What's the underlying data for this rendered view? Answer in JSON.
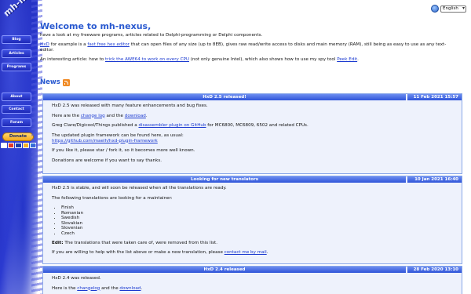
{
  "site": {
    "logo_text": "mh-nexus"
  },
  "nav": {
    "items": [
      "Blog",
      "Articles",
      "Programs",
      "About",
      "Contact",
      "Forum"
    ],
    "donate_label": "Donate",
    "card_colors": [
      "#ffffff",
      "#e03a2a",
      "#1a3ea8",
      "#f2b02a",
      "#2a7ad8"
    ]
  },
  "language": {
    "selected": "English"
  },
  "intro": {
    "title": "Welcome to mh-nexus,",
    "line1": "have a look at my freeware programs, articles related to Delphi-programming or Delphi components.",
    "line2_a": "HxD",
    "line2_b": " for example is a ",
    "line2_c": "fast free hex editor",
    "line2_d": " that can open files of any size (up to 8EB), gives raw read/write access to disks and main memory (RAM), still being as easy to use as any text-",
    "line2_e": "editor.",
    "line3_a": "An interesting article: how to ",
    "line3_b": "trick the AWE64 to work on every CPU",
    "line3_c": " (not only genuine Intel), which also shows how to use my spy tool ",
    "line3_d": "Peek Edit",
    "line3_e": "."
  },
  "news": {
    "heading": "News"
  },
  "posts": [
    {
      "title": "HxD 2.5 released!",
      "date": "11 Feb 2021 15:57",
      "p1": "HxD 2.5 was released with many feature enhancements and bug fixes.",
      "p2_a": "Here are the ",
      "p2_b": "change log",
      "p2_c": " and the ",
      "p2_d": "download",
      "p2_e": ".",
      "p3_a": "Greg Clare/Digicool/Things published a ",
      "p3_b": "disassembler plugin on GitHub",
      "p3_c": " for MC6800, MC6809, 6502 and related CPUs.",
      "p4": "The updated plugin framework can be found here, as usual:",
      "p4_link": "https://github.com/maelh/hxd-plugin-framework",
      "p5": "If you like it, please star / fork it, so it becomes more well known.",
      "p6": "Donations are welcome if you want to say thanks."
    },
    {
      "title": "Looking for new translators",
      "date": "10 Jan 2021 16:40",
      "p1": "HxD 2.5 is stable, and will soon be released when all the translations are ready.",
      "p2": "The following translations are looking for a maintainer:",
      "languages": [
        "Finish",
        "Romanian",
        "Swedish",
        "Slovakian",
        "Slovenian",
        "Czech"
      ],
      "p3_bold": "Edit:",
      "p3_rest": " The translations that were taken care of, were removed from this list.",
      "p4_a": "If you are willing to help with the list above or make a new translation, please ",
      "p4_b": "contact me by mail",
      "p4_c": "."
    },
    {
      "title": "HxD 2.4 released",
      "date": "28 Feb 2020 13:10",
      "p1": "HxD 2.4 was released.",
      "p2_a": "Here is the ",
      "p2_b": "changelog",
      "p2_c": " and the ",
      "p2_d": "download",
      "p2_e": "."
    }
  ]
}
